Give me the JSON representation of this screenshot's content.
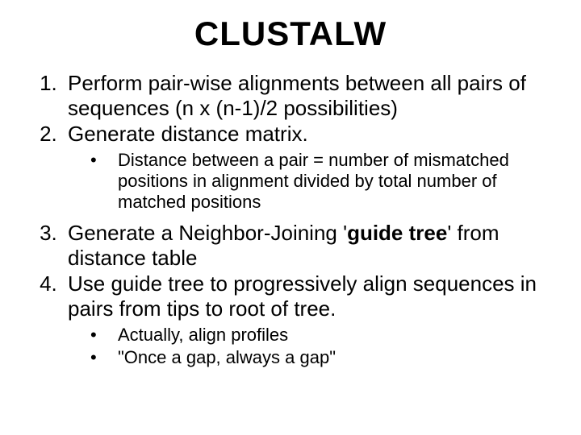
{
  "title": "CLUSTALW",
  "items": {
    "one": "Perform pair-wise alignments between all pairs of sequences (n x (n-1)/2 possibilities)",
    "two": "Generate distance matrix.",
    "two_sub": {
      "a": "Distance between a pair = number of mismatched positions in alignment divided by total number of matched positions"
    },
    "three_pre": "Generate a Neighbor-Joining '",
    "three_bold": "guide tree",
    "three_post": "' from distance table",
    "four": "Use guide tree to progressively align sequences in pairs from tips to root of tree.",
    "four_sub": {
      "a": "Actually, align profiles",
      "b": "\"Once a gap, always a gap\""
    }
  }
}
